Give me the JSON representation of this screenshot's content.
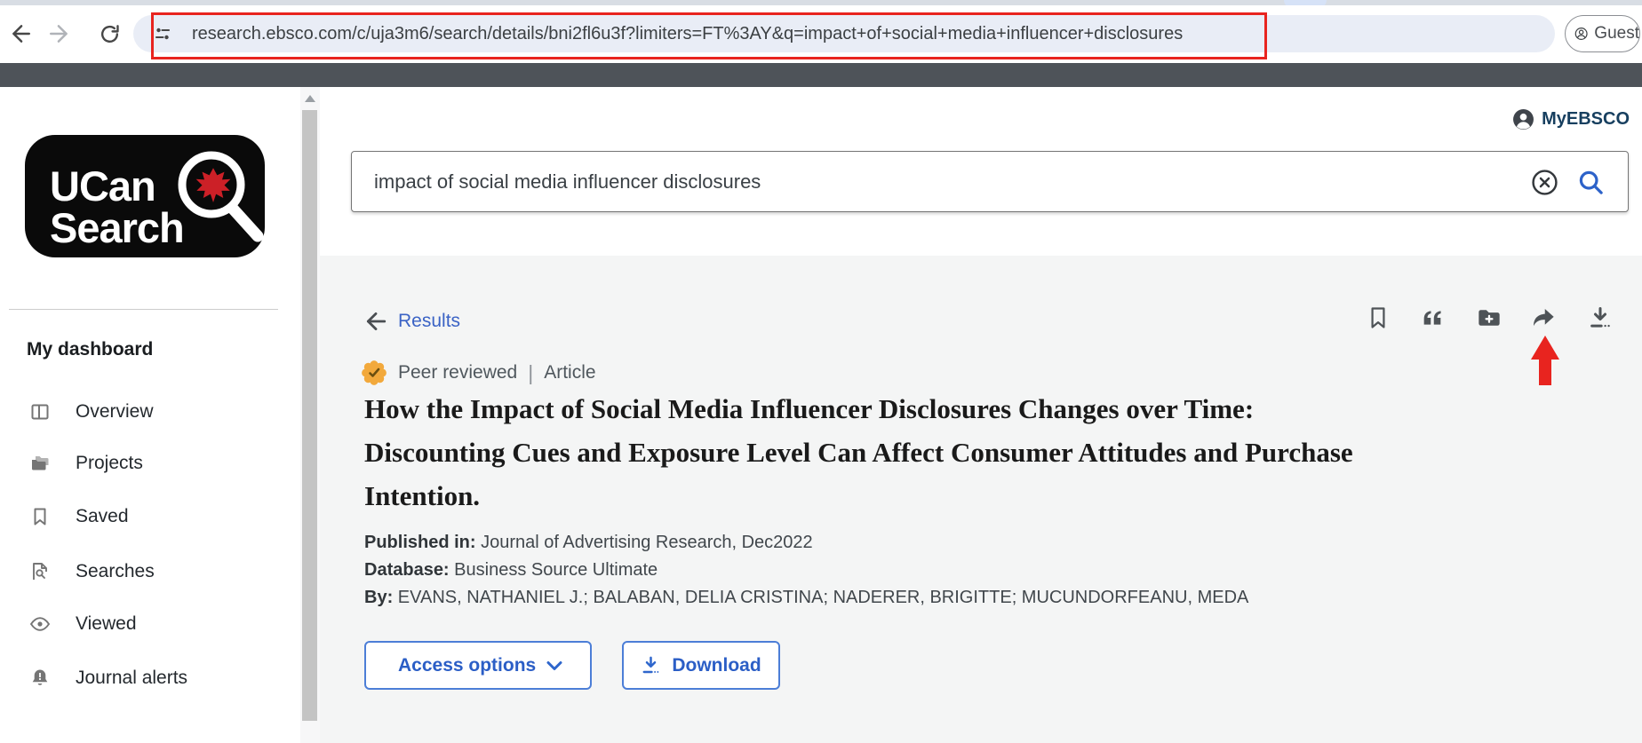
{
  "browser": {
    "url": "research.ebsco.com/c/uja3m6/search/details/bni2fl6u3f?limiters=FT%3AY&q=impact+of+social+media+influencer+disclosures",
    "guest_label": "Guest"
  },
  "sidebar": {
    "logo_line1": "UCan",
    "logo_line2": "Search",
    "section_title": "My dashboard",
    "items": [
      {
        "label": "Overview",
        "icon": "columns-icon"
      },
      {
        "label": "Projects",
        "icon": "folders-icon"
      },
      {
        "label": "Saved",
        "icon": "bookmark-icon"
      },
      {
        "label": "Searches",
        "icon": "search-document-icon"
      },
      {
        "label": "Viewed",
        "icon": "eye-icon"
      },
      {
        "label": "Journal alerts",
        "icon": "bell-alert-icon"
      }
    ]
  },
  "header": {
    "account_label": "MyEBSCO",
    "search_value": "impact of social media influencer disclosures"
  },
  "detail": {
    "back_label": "Results",
    "action_icons": [
      "bookmark",
      "cite",
      "add-to-project",
      "share",
      "download"
    ],
    "peer_reviewed_label": "Peer reviewed",
    "separator": "|",
    "type_label": "Article",
    "title": "How the Impact of Social Media Influencer Disclosures Changes over Time: Discounting Cues and Exposure Level Can Affect Consumer Attitudes and Purchase Intention.",
    "published_label": "Published in:",
    "published_value": "Journal of Advertising Research, Dec2022",
    "database_label": "Database:",
    "database_value": "Business Source Ultimate",
    "by_label": "By:",
    "by_value": "EVANS, NATHANIEL J.; BALABAN, DELIA CRISTINA; NADERER, BRIGITTE; MUCUNDORFEANU, MEDA",
    "access_button": "Access options",
    "download_button": "Download"
  },
  "colors": {
    "accent_blue": "#2d62c9",
    "annotation_red": "#e8241f",
    "badge_orange": "#f2a93c",
    "dark_bar": "#4e5359",
    "myebsco_navy": "#173f5f"
  }
}
